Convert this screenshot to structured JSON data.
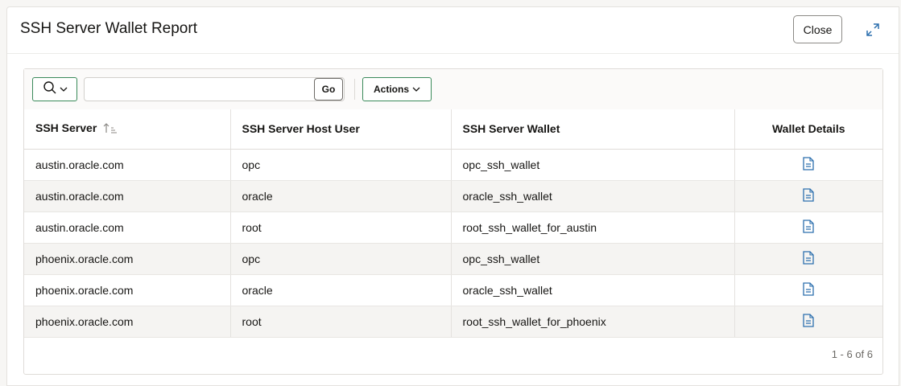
{
  "dialog": {
    "title": "SSH Server Wallet Report",
    "close_label": "Close"
  },
  "toolbar": {
    "search_placeholder": "",
    "go_label": "Go",
    "actions_label": "Actions"
  },
  "table": {
    "headers": [
      "SSH Server",
      "SSH Server Host User",
      "SSH Server Wallet",
      "Wallet Details"
    ],
    "sort": {
      "column": "SSH Server",
      "direction": "ascending"
    },
    "rows": [
      [
        "austin.oracle.com",
        "opc",
        "opc_ssh_wallet"
      ],
      [
        "austin.oracle.com",
        "oracle",
        "oracle_ssh_wallet"
      ],
      [
        "austin.oracle.com",
        "root",
        "root_ssh_wallet_for_austin"
      ],
      [
        "phoenix.oracle.com",
        "opc",
        "opc_ssh_wallet"
      ],
      [
        "phoenix.oracle.com",
        "oracle",
        "oracle_ssh_wallet"
      ],
      [
        "phoenix.oracle.com",
        "root",
        "root_ssh_wallet_for_phoenix"
      ]
    ],
    "details_icon": "document-icon"
  },
  "pagination": {
    "text": "1 - 6 of 6"
  },
  "colors": {
    "accent": "#3a8a5a",
    "icon_blue": "#2c6fae"
  }
}
